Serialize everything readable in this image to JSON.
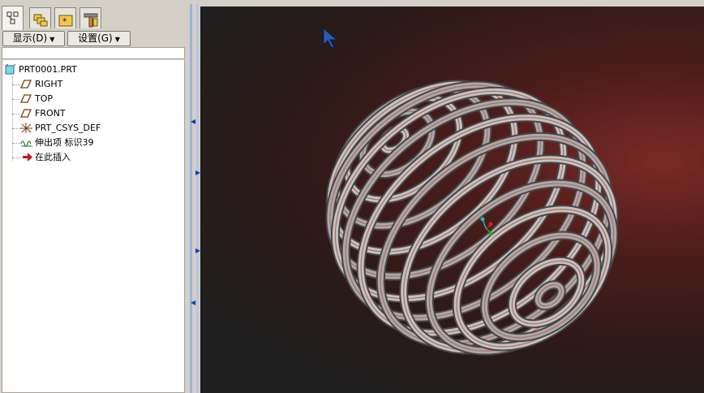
{
  "tabs": [
    {
      "icon": "model-tree-icon",
      "active": true
    },
    {
      "icon": "folder-browser-icon",
      "active": false
    },
    {
      "icon": "favorites-icon",
      "active": false
    },
    {
      "icon": "connections-icon",
      "active": false
    }
  ],
  "toolbar": {
    "show_label": "显示(D)",
    "settings_label": "设置(G)"
  },
  "tree": {
    "root": "PRT0001.PRT",
    "items": [
      {
        "label": "RIGHT",
        "icon": "datum-plane-icon"
      },
      {
        "label": "TOP",
        "icon": "datum-plane-icon"
      },
      {
        "label": "FRONT",
        "icon": "datum-plane-icon"
      },
      {
        "label": "PRT_CSYS_DEF",
        "icon": "coordinate-system-icon"
      },
      {
        "label": "伸出项 标识39",
        "icon": "sweep-protrusion-icon"
      },
      {
        "label": "在此插入",
        "icon": "insert-here-arrow-icon"
      }
    ]
  },
  "viewport": {
    "model": "spherical-helix-spring",
    "colors": {
      "accent_red": "#c0302a",
      "spring": "#9a9a9a"
    }
  }
}
